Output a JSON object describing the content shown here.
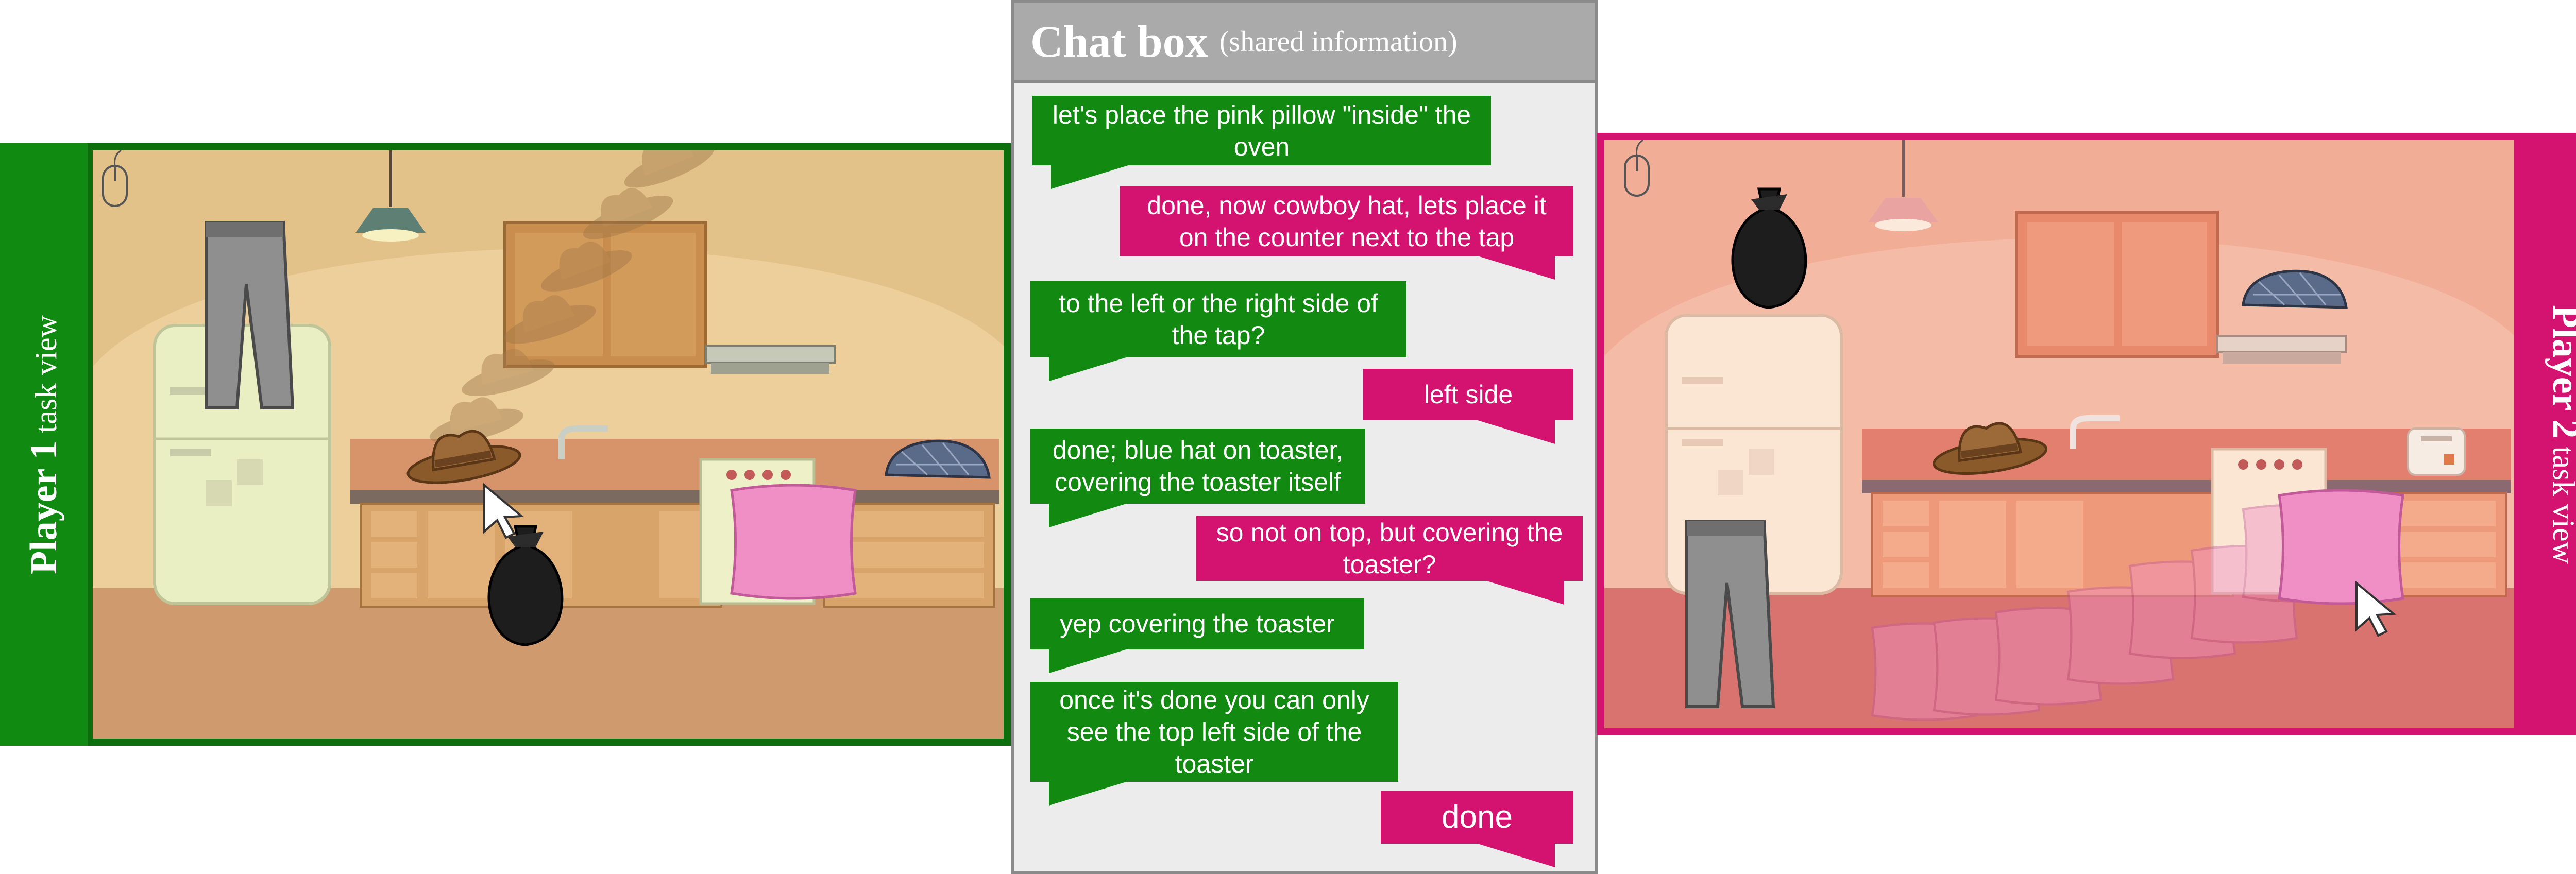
{
  "player1": {
    "label_bold": "Player 1",
    "label_rest": " task view"
  },
  "player2": {
    "label_bold": "Player 2",
    "label_rest": " task view"
  },
  "chat": {
    "title": "Chat box",
    "subtitle": "(shared information)",
    "messages": [
      {
        "from": "player1",
        "text": "let's place the pink pillow \"inside\" the oven"
      },
      {
        "from": "player2",
        "text": "done, now cowboy hat, lets place it on the counter next to the tap"
      },
      {
        "from": "player1",
        "text": "to the left or the right side of the tap?"
      },
      {
        "from": "player2",
        "text": "left side"
      },
      {
        "from": "player1",
        "text": "done; blue hat on toaster, covering the toaster itself"
      },
      {
        "from": "player2",
        "text": "so not on top, but covering the toaster?"
      },
      {
        "from": "player1",
        "text": "yep covering the toaster"
      },
      {
        "from": "player1",
        "text": "once it's done you can only see the top left side of the toaster"
      },
      {
        "from": "player2",
        "text": "done"
      }
    ]
  },
  "colors": {
    "player1": "#128a12",
    "player2": "#d4126f",
    "chat_header": "#aaaaaa"
  },
  "icons": [
    "mouse-icon",
    "cursor-icon"
  ],
  "scene_objects": [
    "pants",
    "cowboy-hat",
    "garbage-bag",
    "pink-pillow",
    "flat-cap",
    "toaster",
    "fridge",
    "oven",
    "tap",
    "cabinets",
    "lamp"
  ]
}
